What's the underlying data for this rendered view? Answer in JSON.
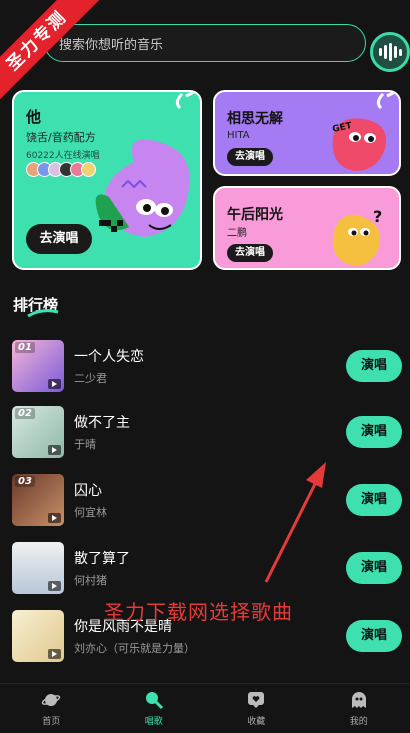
{
  "watermark": {
    "ribbon_text": "圣力专测",
    "annotation": "圣力下载网选择歌曲"
  },
  "search": {
    "placeholder": "搜索你想听的音乐"
  },
  "featured": [
    {
      "title": "他",
      "subtitle": "饶舌/音药配方",
      "count": "60222人在线演唱",
      "button": "去演唱",
      "color": "#3ee0b0"
    },
    {
      "title": "相思无解",
      "subtitle": "HITA",
      "button": "去演唱",
      "color": "#a57bf4"
    },
    {
      "title": "午后阳光",
      "subtitle": "二鹏",
      "button": "去演唱",
      "color": "#fa9bd9"
    }
  ],
  "ranking": {
    "title": "排行榜",
    "items": [
      {
        "rank": "01",
        "title": "一个人失恋",
        "artist": "二少君",
        "button": "演唱"
      },
      {
        "rank": "02",
        "title": "做不了主",
        "artist": "于晴",
        "button": "演唱"
      },
      {
        "rank": "03",
        "title": "囚心",
        "artist": "何宜林",
        "button": "演唱"
      },
      {
        "rank": "",
        "title": "散了算了",
        "artist": "何村猪",
        "button": "演唱"
      },
      {
        "rank": "",
        "title": "你是风雨不是晴",
        "artist": "刘亦心（可乐就是力量）",
        "button": "演唱"
      }
    ]
  },
  "nav": [
    {
      "label": "首页",
      "icon": "planet-icon"
    },
    {
      "label": "唱歌",
      "icon": "microphone-icon",
      "active": true
    },
    {
      "label": "收藏",
      "icon": "heart-chat-icon"
    },
    {
      "label": "我的",
      "icon": "ghost-icon"
    }
  ],
  "colors": {
    "accent": "#3ee0b0",
    "annotation": "#e53a3a"
  }
}
